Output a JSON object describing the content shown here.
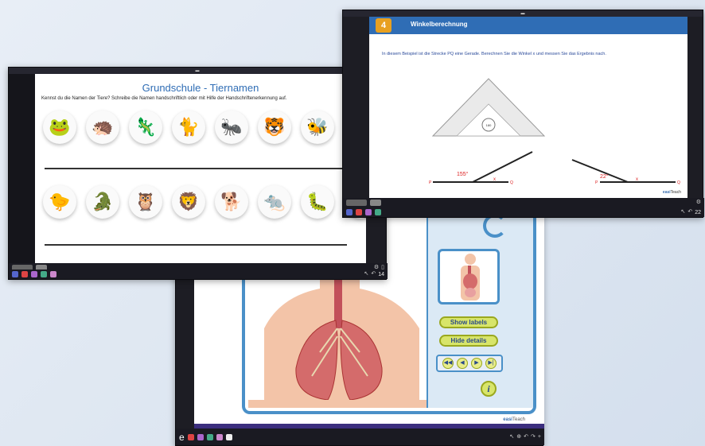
{
  "tiere_window": {
    "title": "Grundschule - Tiernamen",
    "instruction": "Kennst du die Namen der Tiere? Schreibe die Namen handschriftlich oder mit Hilfe der Handschriftenerkennung auf.",
    "page_number": "14"
  },
  "winkel_window": {
    "title": "Winkelberechnung",
    "instruction": "In diesem Beispiel ist die Strecke PQ eine Gerade. Berechnen Sie die Winkel x und messen Sie das Ergebnis nach.",
    "ruler_label": "180",
    "angle_left": "155°",
    "angle_right": "22°",
    "unknown_label": "x",
    "point_p": "P",
    "point_q": "Q",
    "brand_prefix": "easi",
    "brand_suffix": "Teach",
    "page_number": "22"
  },
  "lungs_window": {
    "show_labels": "Show labels",
    "hide_details": "Hide details",
    "info_label": "i",
    "brand_prefix": "easi",
    "brand_suffix": "Teach"
  }
}
